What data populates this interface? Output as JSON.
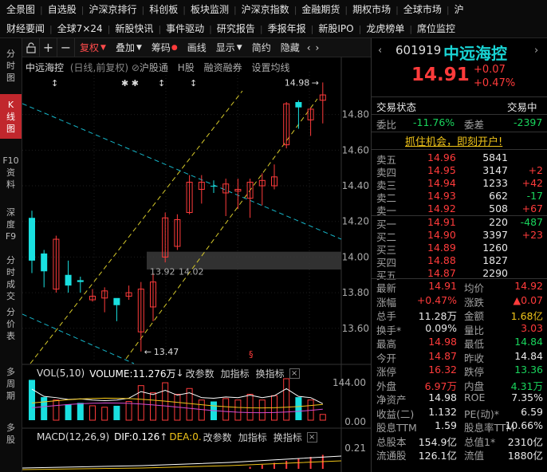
{
  "nav": {
    "row1": [
      "全景图",
      "自选股",
      "沪深京排行",
      "科创板",
      "板块监测",
      "沪深京指数",
      "金融期货",
      "期权市场",
      "全球市场",
      "沪"
    ],
    "row2": [
      "财经要闻",
      "全球7×24",
      "新股快讯",
      "事件驱动",
      "研究报告",
      "季报年报",
      "新股IPO",
      "龙虎榜单",
      "席位监控"
    ]
  },
  "sidebar": [
    "分时图",
    "K线图",
    "F10资料",
    "深度F9",
    "分时成交",
    "分价表",
    "多周期",
    "多股"
  ],
  "toolbar": {
    "restore": "复权",
    "overlay": "叠加",
    "chips": "筹码",
    "draw": "画线",
    "display": "显示",
    "simple": "简约",
    "hide": "隐藏"
  },
  "kline": {
    "name": "中远海控",
    "period": "(日线,前复权)",
    "hk_link": "沪股通",
    "h_share": "H股",
    "margin": "融资融券",
    "ma_setting": "设置均线",
    "high_label": "14.98",
    "low_label": "13.47",
    "mid_label1": "13.92",
    "mid_label2": "14.02",
    "y_ticks": [
      "14.80",
      "14.60",
      "14.40",
      "14.20",
      "14.00",
      "13.80",
      "13.60"
    ],
    "candles": [
      [
        13.98,
        14.22,
        13.91,
        14.26
      ],
      [
        14.02,
        13.92,
        13.83,
        14.04
      ],
      [
        13.82,
        14.1,
        13.8,
        14.12
      ],
      [
        13.9,
        13.84,
        13.8,
        13.98
      ],
      [
        13.86,
        13.87,
        13.8,
        13.89
      ],
      [
        13.76,
        13.78,
        13.75,
        13.82
      ],
      [
        13.77,
        13.81,
        13.69,
        13.83
      ],
      [
        13.77,
        13.73,
        13.64,
        13.76
      ],
      [
        13.78,
        13.8,
        13.76,
        13.84
      ],
      [
        13.58,
        13.82,
        13.47,
        13.86
      ],
      [
        13.72,
        13.86,
        13.64,
        13.91
      ],
      [
        14.0,
        14.22,
        13.97,
        14.25
      ],
      [
        14.06,
        14.21,
        14.04,
        14.24
      ],
      [
        14.25,
        14.42,
        14.24,
        14.46
      ],
      [
        14.42,
        14.38,
        14.3,
        14.46
      ],
      [
        14.4,
        14.4,
        14.36,
        14.43
      ],
      [
        14.36,
        14.41,
        14.23,
        14.44
      ],
      [
        14.38,
        14.37,
        14.27,
        14.44
      ],
      [
        14.33,
        14.42,
        14.22,
        14.44
      ],
      [
        14.43,
        14.4,
        14.29,
        14.47
      ],
      [
        14.4,
        14.45,
        14.38,
        14.52
      ],
      [
        14.63,
        14.86,
        14.61,
        14.87
      ],
      [
        14.84,
        14.87,
        14.72,
        14.88
      ],
      [
        14.83,
        14.77,
        14.68,
        14.84
      ],
      [
        14.88,
        14.91,
        14.75,
        14.98
      ]
    ],
    "candle_colors": [
      "cyan",
      "cyan",
      "red",
      "cyan",
      "cyan",
      "red",
      "red",
      "cyan",
      "red",
      "red",
      "red",
      "red",
      "red",
      "red",
      "red",
      "cyan",
      "red",
      "red",
      "red",
      "red",
      "red",
      "red",
      "cyan",
      "red",
      "red"
    ]
  },
  "vol": {
    "label": "VOL(5,10)",
    "value_label": "VOLUME:11.276万",
    "action1": "改参数",
    "action2": "加指标",
    "action3": "换指标",
    "ytop": "144.00",
    "ybottom": "0.00"
  },
  "macd": {
    "label": "MACD(12,26,9)",
    "dif": "DIF:0.126",
    "dea": "DEA:0.",
    "action1": "改参数",
    "action2": "加指标",
    "action3": "换指标",
    "ytop": "0.21"
  },
  "stock": {
    "code": "601919",
    "name": "中远海控",
    "price": "14.91",
    "change": "+0.07",
    "pct": "+0.47%"
  },
  "status": {
    "label": "交易状态",
    "value": "交易中",
    "weibi_label": "委比",
    "weibi": "-11.76%",
    "weicha_label": "委差",
    "weicha": "-2397",
    "promo": "抓住机会，即刻开户!"
  },
  "asks": [
    {
      "label": "卖五",
      "price": "14.96",
      "vol": "5841",
      "chg": ""
    },
    {
      "label": "卖四",
      "price": "14.95",
      "vol": "3147",
      "chg": "+2"
    },
    {
      "label": "卖三",
      "price": "14.94",
      "vol": "1233",
      "chg": "+42"
    },
    {
      "label": "卖二",
      "price": "14.93",
      "vol": "662",
      "chg": "-17"
    },
    {
      "label": "卖一",
      "price": "14.92",
      "vol": "508",
      "chg": "+67"
    }
  ],
  "bids": [
    {
      "label": "买一",
      "price": "14.91",
      "vol": "220",
      "chg": "-487"
    },
    {
      "label": "买二",
      "price": "14.90",
      "vol": "3397",
      "chg": "+23"
    },
    {
      "label": "买三",
      "price": "14.89",
      "vol": "1260",
      "chg": ""
    },
    {
      "label": "买四",
      "price": "14.88",
      "vol": "1827",
      "chg": ""
    },
    {
      "label": "买五",
      "price": "14.87",
      "vol": "2290",
      "chg": ""
    }
  ],
  "quote": [
    [
      "最新",
      "14.91",
      "均价",
      "14.92"
    ],
    [
      "涨幅",
      "+0.47%",
      "涨跌",
      "▲0.07"
    ],
    [
      "总手",
      "11.28万",
      "金额",
      "1.68亿"
    ],
    [
      "换手*",
      "0.09%",
      "量比",
      "3.03"
    ],
    [
      "最高",
      "14.98",
      "最低",
      "14.84"
    ],
    [
      "今开",
      "14.87",
      "昨收",
      "14.84"
    ],
    [
      "涨停",
      "16.32",
      "跌停",
      "13.36"
    ],
    [
      "外盘",
      "6.97万",
      "内盘",
      "4.31万"
    ],
    [
      "净资产",
      "14.98",
      "ROE",
      "7.35%"
    ],
    [
      "收益(二)",
      "1.132",
      "PE(动)*",
      "6.59"
    ],
    [
      "股息TTM",
      "1.59",
      "股息率TTM",
      "10.66%"
    ],
    [
      "总股本",
      "154.9亿",
      "总值1*",
      "2310亿"
    ],
    [
      "流通股",
      "126.1亿",
      "流值",
      "1880亿"
    ]
  ],
  "quote_colors": [
    [
      "red",
      "red"
    ],
    [
      "red",
      "red"
    ],
    [
      "white",
      "yel"
    ],
    [
      "white",
      "red"
    ],
    [
      "red",
      "green"
    ],
    [
      "red",
      "white"
    ],
    [
      "red",
      "green"
    ],
    [
      "red",
      "green"
    ],
    [
      "white",
      "white"
    ],
    [
      "white",
      "white"
    ],
    [
      "white",
      "white"
    ],
    [
      "white",
      "white"
    ],
    [
      "white",
      "white"
    ]
  ]
}
